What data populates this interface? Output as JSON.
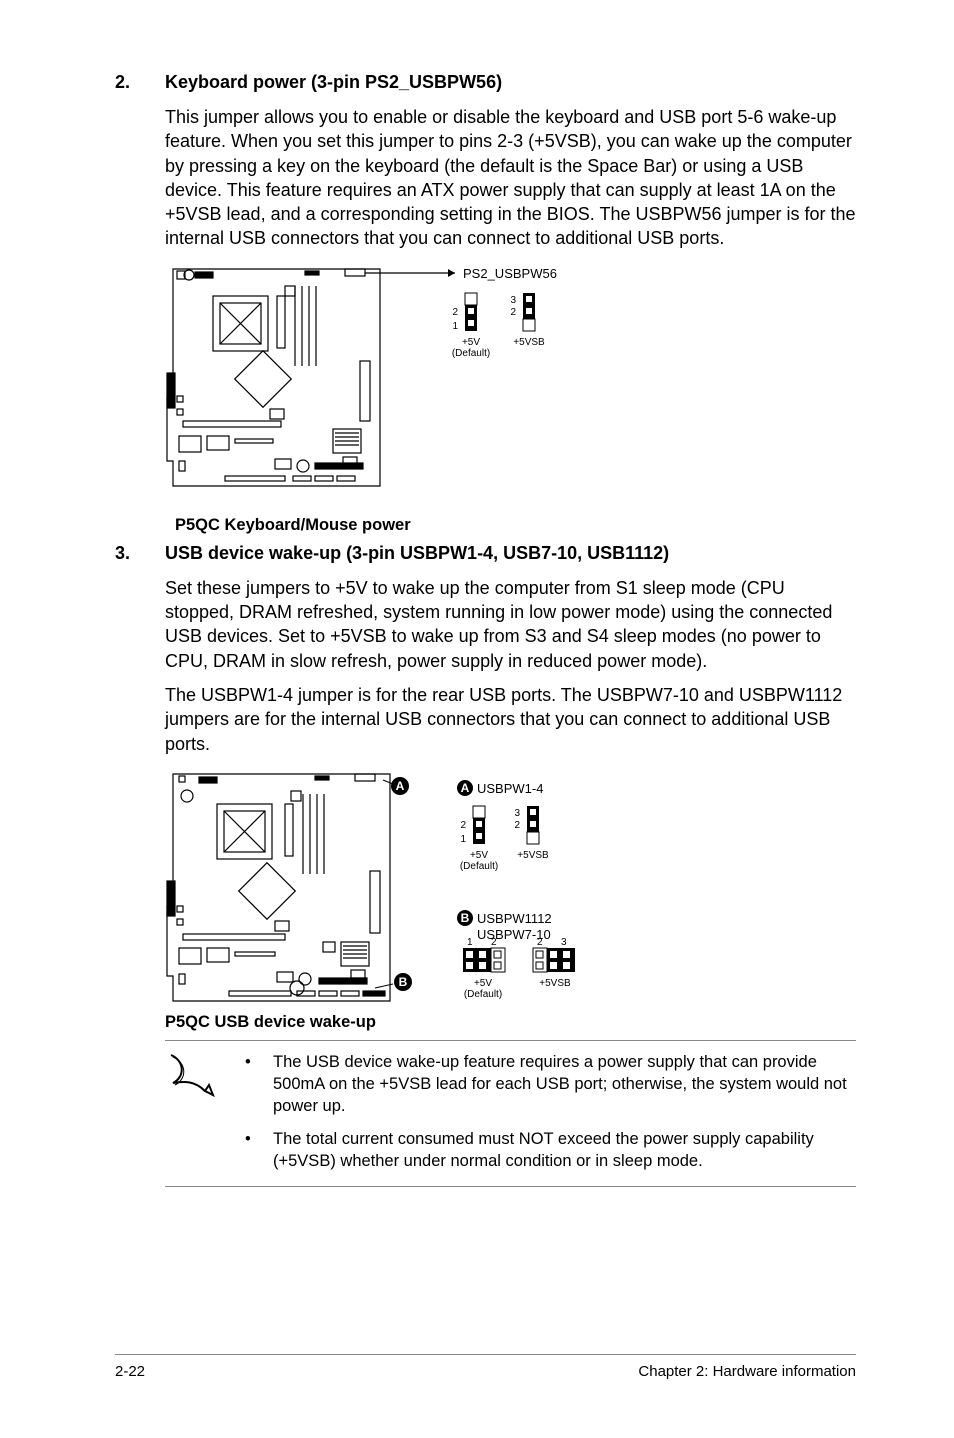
{
  "section2": {
    "num": "2.",
    "title": "Keyboard power (3-pin PS2_USBPW56)",
    "para": "This jumper allows you to enable or disable the keyboard and USB port 5-6 wake-up feature. When you set this jumper to pins 2-3 (+5VSB), you can wake up the computer by pressing a key on the keyboard (the default is the Space Bar) or using a USB device. This feature requires an ATX power supply that can supply at least 1A on the +5VSB lead, and a corresponding setting in the BIOS. The USBPW56 jumper is for the internal USB connectors that you can connect to additional USB ports.",
    "diagram_label": "PS2_USBPW56",
    "pin_labels": {
      "p1": "1",
      "p2": "2",
      "p3": "3"
    },
    "mode_a": "+5V",
    "mode_a_sub": "(Default)",
    "mode_b": "+5VSB",
    "caption": "P5QC Keyboard/Mouse power"
  },
  "section3": {
    "num": "3.",
    "title": "USB device wake-up (3-pin USBPW1-4, USB7-10, USB1112)",
    "para1": "Set these jumpers to +5V to wake up the computer from S1 sleep mode (CPU stopped, DRAM refreshed, system running in low power mode) using the connected USB devices. Set to +5VSB to wake up from S3 and S4 sleep modes (no power to CPU, DRAM in slow refresh, power supply in reduced power mode).",
    "para2": "The USBPW1-4 jumper is for the rear USB ports. The USBPW7-10 and USBPW1112 jumpers are for the internal USB connectors that you can connect to additional USB ports.",
    "badge_a": "A",
    "badge_b": "B",
    "label_a": "USBPW1-4",
    "label_b1": "USBPW1112",
    "label_b2": "USBPW7-10",
    "pin_labels": {
      "p1": "1",
      "p2": "2",
      "p3": "3"
    },
    "mode_a": "+5V",
    "mode_a_sub": "(Default)",
    "mode_b": "+5VSB",
    "caption": "P5QC USB device wake-up"
  },
  "notes": {
    "item1": "The USB device wake-up feature requires a power supply that can provide 500mA on the +5VSB lead for each USB port; otherwise, the system would not power up.",
    "item2": "The total current consumed must NOT exceed the power supply capability (+5VSB) whether under normal condition or in sleep mode."
  },
  "footer": {
    "left": "2-22",
    "right": "Chapter 2: Hardware information"
  }
}
